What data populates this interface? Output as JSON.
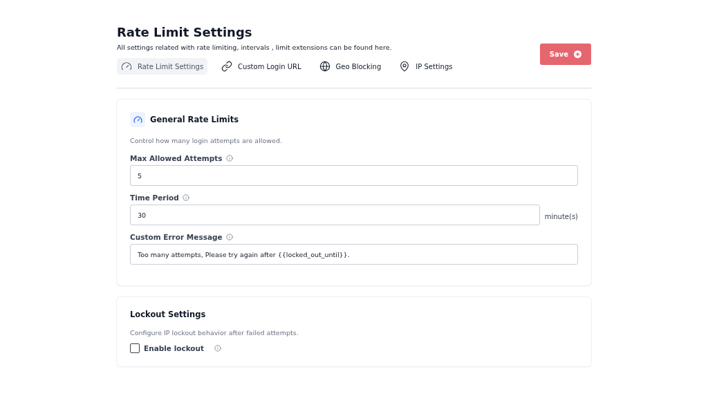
{
  "header": {
    "title": "Rate Limit Settings",
    "description": "All settings related with rate limiting, intervals , limit extensions can be found here."
  },
  "tabs": [
    {
      "label": "Rate Limit Settings",
      "kind": "gauge",
      "selected": true
    },
    {
      "label": "Custom Login URL",
      "kind": "link",
      "selected": false
    },
    {
      "label": "Geo Blocking",
      "kind": "globe",
      "selected": false
    },
    {
      "label": "IP Settings",
      "kind": "pin",
      "selected": false
    }
  ],
  "save_button": {
    "label": "Save"
  },
  "general_card": {
    "title": "General Rate Limits",
    "description": "Control how many login attempts are allowed.",
    "fields": [
      {
        "label": "Max Allowed Attempts",
        "value": "5"
      },
      {
        "label": "Time Period",
        "value": "30",
        "suffix": "minute(s)"
      },
      {
        "label": "Custom Error Message",
        "value": "Too many attempts, Please try again after {{locked_out_until}}."
      }
    ]
  },
  "lockout_card": {
    "title": "Lockout Settings",
    "description": "Configure IP lockout behavior after failed attempts.",
    "checkbox": {
      "label": "Enable lockout",
      "checked": false
    }
  }
}
